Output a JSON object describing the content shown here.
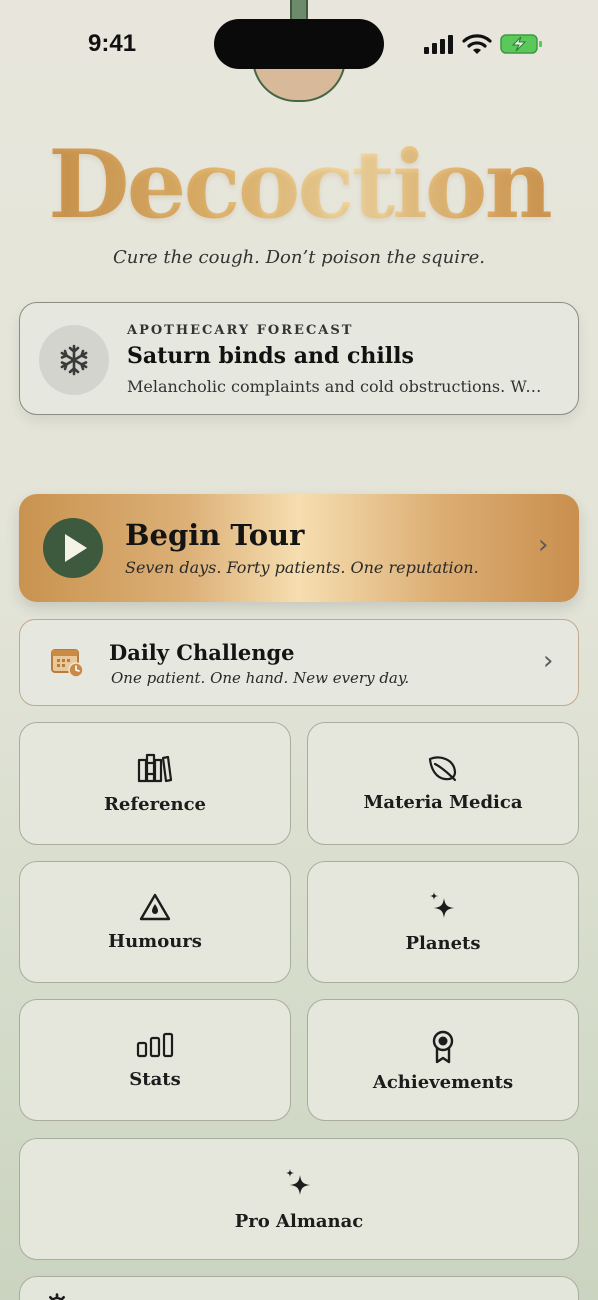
{
  "status_bar": {
    "time": "9:41"
  },
  "app": {
    "logo": "Decoction",
    "tagline": "Cure the cough. Don’t poison the squire."
  },
  "forecast": {
    "kicker": "APOTHECARY FORECAST",
    "title": "Saturn binds and chills",
    "description": "Melancholic complaints and cold obstructions. Wa...",
    "icon": "snowflake-icon"
  },
  "tour": {
    "title": "Begin Tour",
    "subtitle": "Seven days. Forty patients. One reputation.",
    "icon": "play-icon"
  },
  "daily": {
    "title": "Daily Challenge",
    "subtitle": "One patient. One hand. New every day.",
    "icon": "calendar-clock-icon"
  },
  "tiles": {
    "reference": {
      "label": "Reference",
      "icon": "books-icon"
    },
    "materia": {
      "label": "Materia Medica",
      "icon": "leaf-icon"
    },
    "humours": {
      "label": "Humours",
      "icon": "drop-triangle-icon"
    },
    "planets": {
      "label": "Planets",
      "icon": "sparkles-icon"
    },
    "stats": {
      "label": "Stats",
      "icon": "bar-chart-icon"
    },
    "achievements": {
      "label": "Achievements",
      "icon": "award-icon"
    },
    "pro": {
      "label": "Pro Almanac",
      "icon": "sparkles-icon"
    }
  },
  "colors": {
    "gold": "#d9a862",
    "forest": "#3d5a3f",
    "card_bg": "#e6e7de",
    "battery_green": "#5ac85a"
  }
}
